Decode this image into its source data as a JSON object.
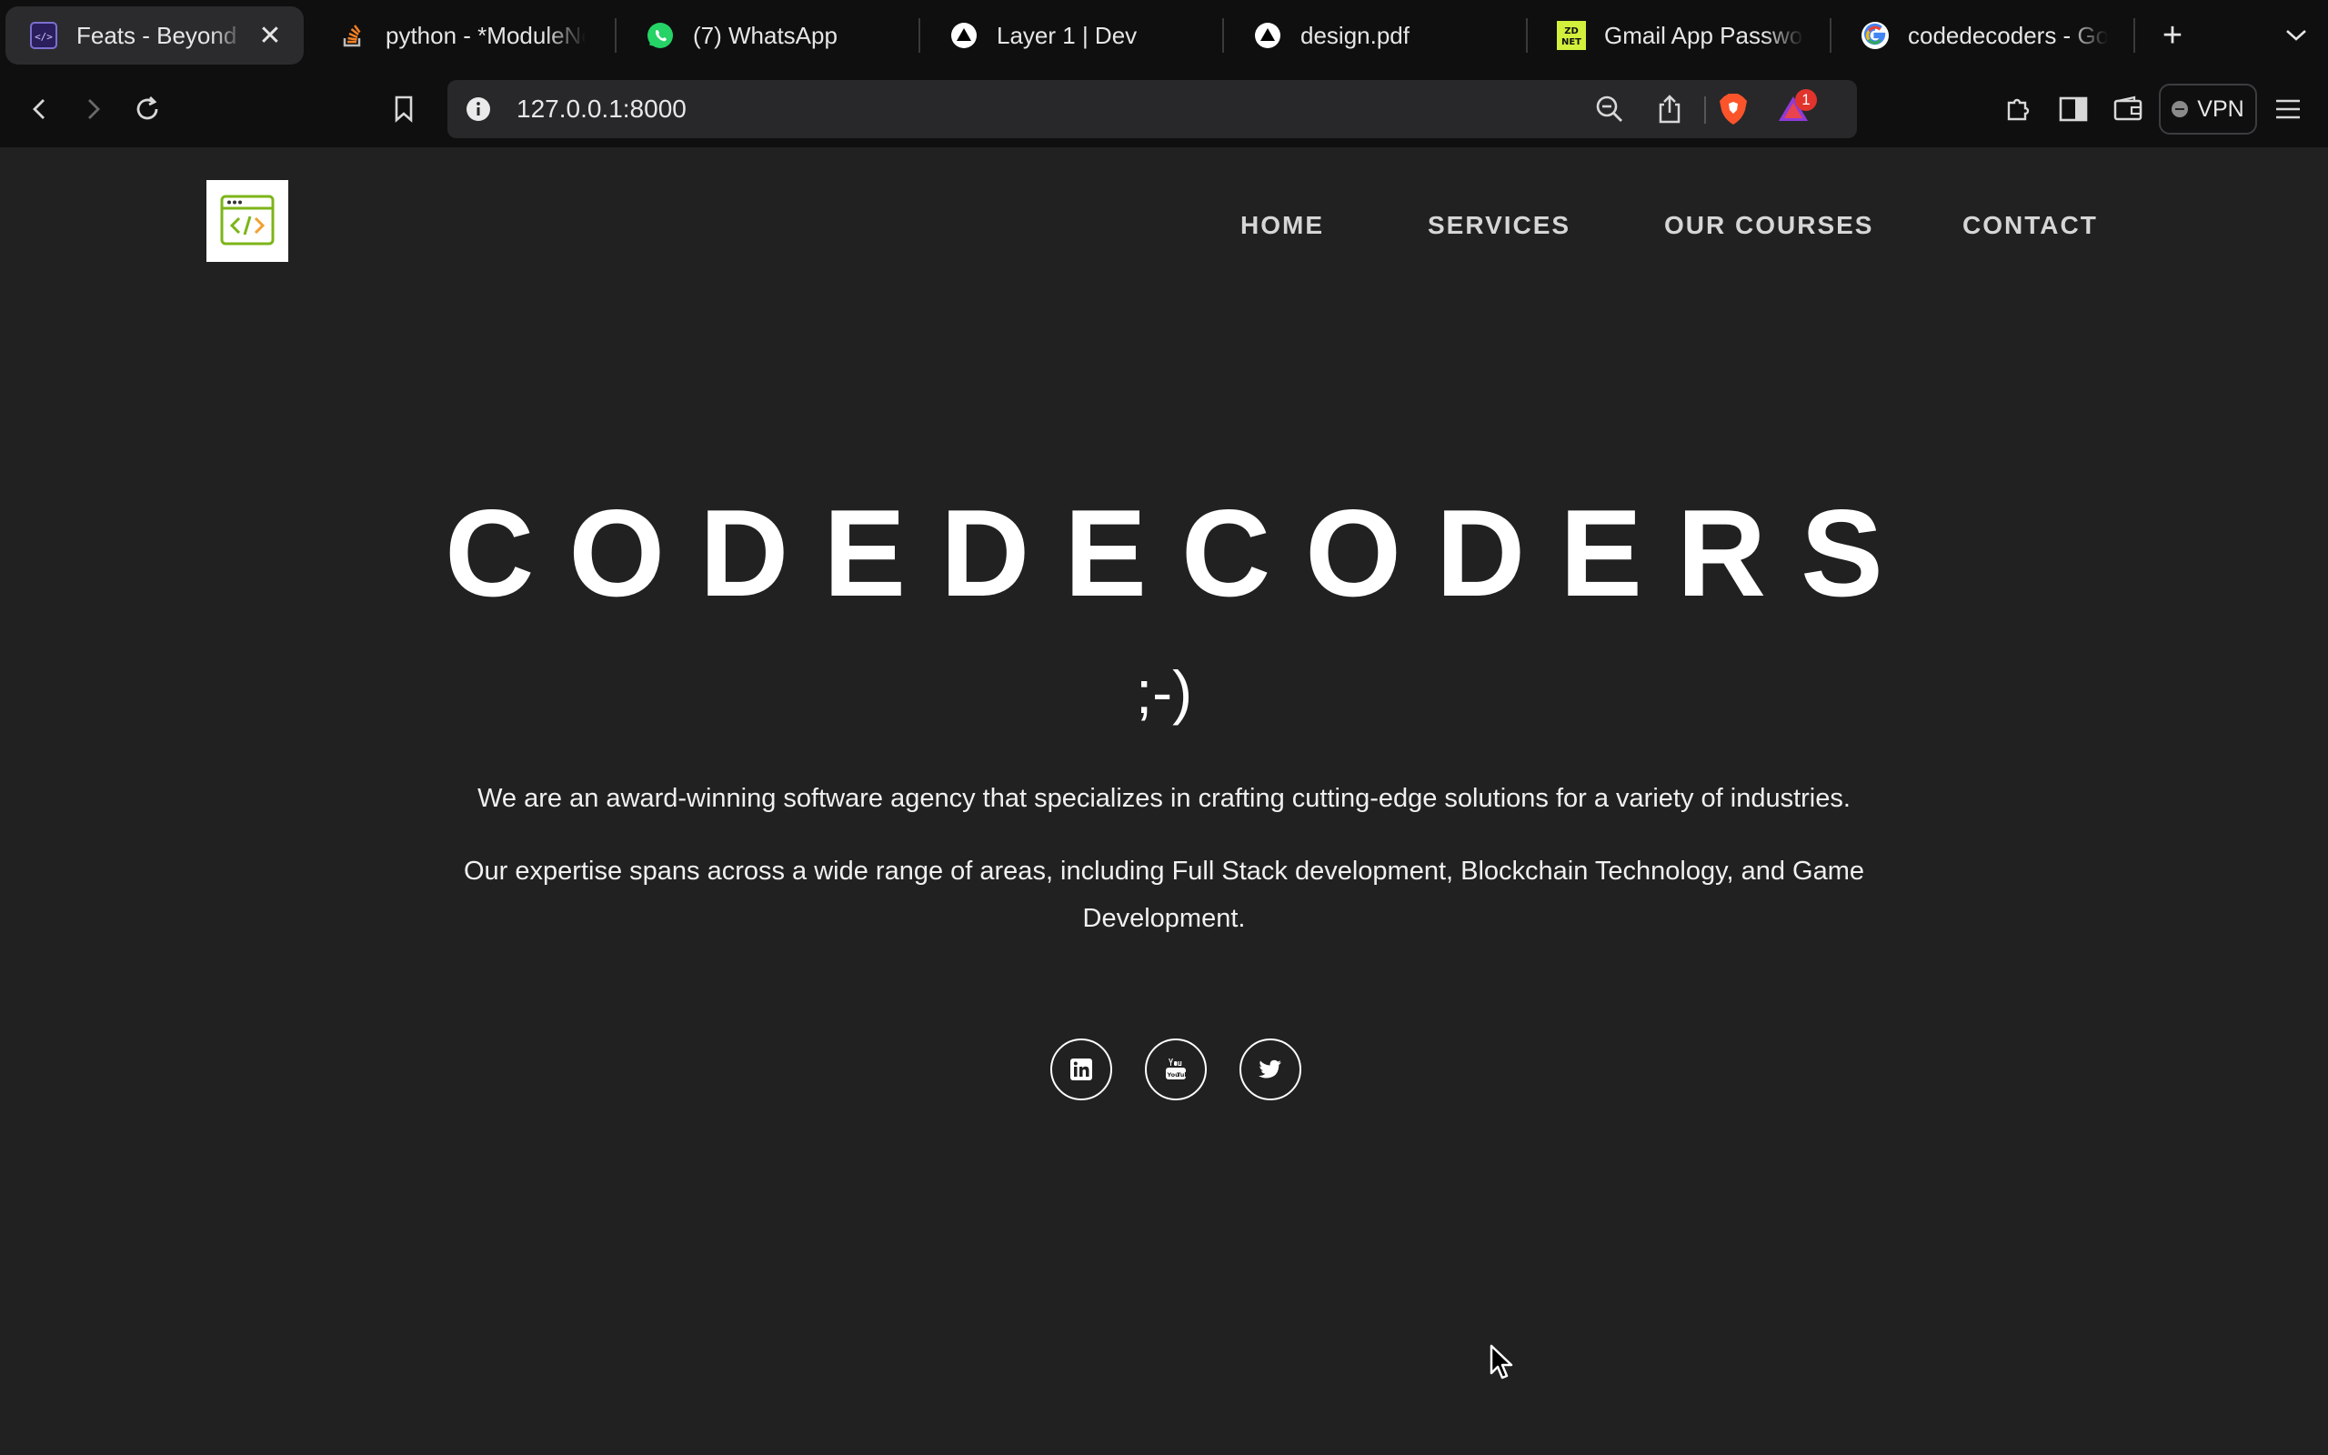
{
  "browser": {
    "tabs": [
      {
        "title": "Feats - Beyond the",
        "favicon": "codedecoders-favicon",
        "active": true,
        "close": "✕"
      },
      {
        "title": "python - *ModuleNot",
        "favicon": "stackoverflow-icon"
      },
      {
        "title": "(7) WhatsApp",
        "favicon": "whatsapp-icon"
      },
      {
        "title": "Layer 1 | Dev",
        "favicon": "triangle-icon"
      },
      {
        "title": "design.pdf",
        "favicon": "triangle-icon"
      },
      {
        "title": "Gmail App Password",
        "favicon": "zdnet-icon"
      },
      {
        "title": "codedecoders - Goo",
        "favicon": "google-icon"
      }
    ],
    "new_tab": "+",
    "address": "127.0.0.1:8000",
    "rewards_badge": "1",
    "vpn_label": "VPN"
  },
  "site": {
    "nav": {
      "home": "HOME",
      "services": "SERVICES",
      "courses": "OUR COURSES",
      "contact": "CONTACT"
    },
    "hero": {
      "title": "CODEDECODERS",
      "subtitle": ";-)",
      "paragraph1": "We are an award-winning software agency that specializes in crafting cutting-edge solutions for a variety of industries.",
      "paragraph2": "Our expertise spans across a wide range of areas, including Full Stack development, Blockchain Technology, and Game Development."
    },
    "social": [
      "linkedin-icon",
      "youtube-icon",
      "twitter-icon"
    ]
  },
  "colors": {
    "page_bg": "#212121",
    "chrome_bg": "#0f0f10",
    "logo_green": "#7cb518",
    "logo_orange": "#f0a030"
  }
}
